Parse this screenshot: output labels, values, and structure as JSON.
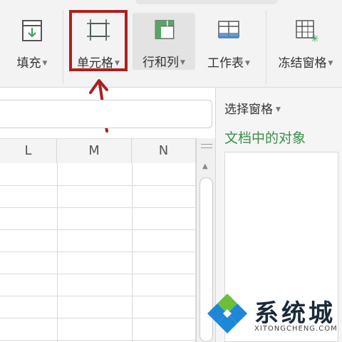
{
  "ribbon": {
    "tools": [
      {
        "label": "填充",
        "icon": "fill-down-icon"
      },
      {
        "label": "单元格",
        "icon": "cell-icon"
      },
      {
        "label": "行和列",
        "icon": "rows-columns-icon"
      },
      {
        "label": "工作表",
        "icon": "worksheet-icon"
      },
      {
        "label": "冻结窗格",
        "icon": "freeze-panes-icon"
      }
    ],
    "highlight_color": "#b01e1e"
  },
  "sheet": {
    "columns": [
      "L",
      "M",
      "N"
    ]
  },
  "selection_pane": {
    "title": "选择窗格",
    "subtitle": "文档中的对象",
    "accent": "#3a8f4a"
  },
  "watermark": {
    "name": "系统城",
    "site": "XITONGCHENG.COM"
  }
}
